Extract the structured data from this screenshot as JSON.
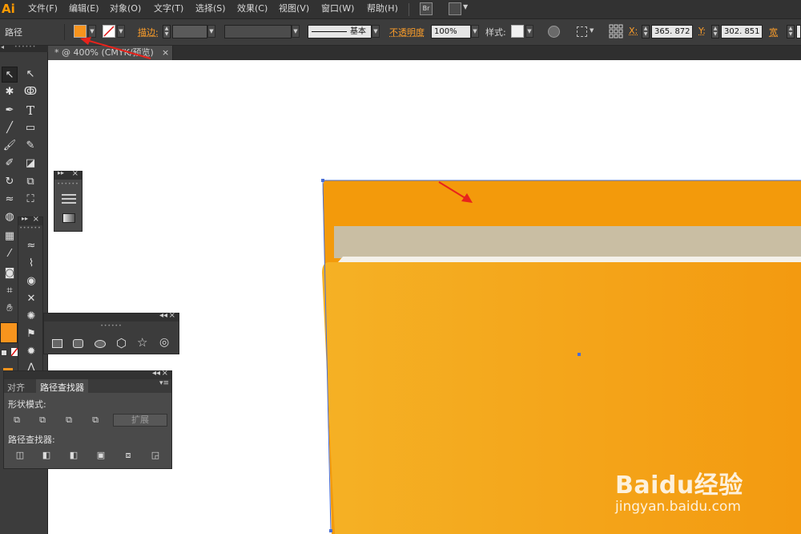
{
  "app": {
    "logo": "Ai"
  },
  "menu": [
    "文件(F)",
    "编辑(E)",
    "对象(O)",
    "文字(T)",
    "选择(S)",
    "效果(C)",
    "视图(V)",
    "窗口(W)",
    "帮助(H)"
  ],
  "menubar_icons": [
    "bridge-icon",
    "arrange-documents-icon"
  ],
  "control_bar": {
    "selection_label": "路径",
    "fill_color": "#f7941d",
    "stroke_swatch": "none",
    "stroke_label": "描边:",
    "stroke_style_label": "基本",
    "opacity_label": "不透明度",
    "opacity_value": "100%",
    "style_label": "样式:",
    "x_label": "X:",
    "x_value": "365. 872",
    "y_label": "Y:",
    "y_value": "302. 851",
    "w_label": "宽"
  },
  "document_tab": {
    "title": "* @ 400% (CMYK/预览)",
    "close": "×"
  },
  "tools": [
    "selection-tool",
    "direct-selection-tool",
    "magic-wand-tool",
    "lasso-tool",
    "pen-tool",
    "type-tool",
    "line-segment-tool",
    "rectangle-tool",
    "paintbrush-tool",
    "pencil-tool",
    "blob-brush-tool",
    "eraser-tool",
    "rotate-tool",
    "scale-tool",
    "width-tool",
    "free-transform-tool",
    "shape-builder-tool",
    "perspective-grid-tool",
    "mesh-tool",
    "gradient-tool",
    "eyedropper-tool",
    "blend-tool",
    "symbol-sprayer-tool",
    "column-graph-tool",
    "artboard-tool",
    "slice-tool",
    "hand-tool",
    "zoom-tool"
  ],
  "tool_colors": {
    "fill": "#f7941d",
    "stroke": "#ffffff"
  },
  "shape_flyout": [
    "rectangle-icon",
    "rounded-rectangle-icon",
    "ellipse-icon",
    "polygon-icon",
    "star-icon",
    "flare-icon"
  ],
  "pathfinder_panel": {
    "tabs": [
      "对齐",
      "路径查找器"
    ],
    "active_tab": 1,
    "shape_modes_label": "形状模式:",
    "shape_modes": [
      "unite-icon",
      "minus-front-icon",
      "intersect-icon",
      "exclude-icon"
    ],
    "expand_label": "扩展",
    "pathfinders_label": "路径查找器:",
    "pathfinders": [
      "divide-icon",
      "trim-icon",
      "merge-icon",
      "crop-icon",
      "outline-icon",
      "minus-back-icon"
    ]
  },
  "artwork": {
    "folder_back_color": "#f39a0b",
    "paper_color": "#c9bea3",
    "folder_front_left": "#f5b125",
    "folder_front_right": "#f39a10",
    "selection_color": "#4a6fd6",
    "annotation_arrow_color": "#e8231c"
  },
  "watermark": {
    "logo_text": "Baidu经验",
    "url": "jingyan.baidu.com"
  }
}
